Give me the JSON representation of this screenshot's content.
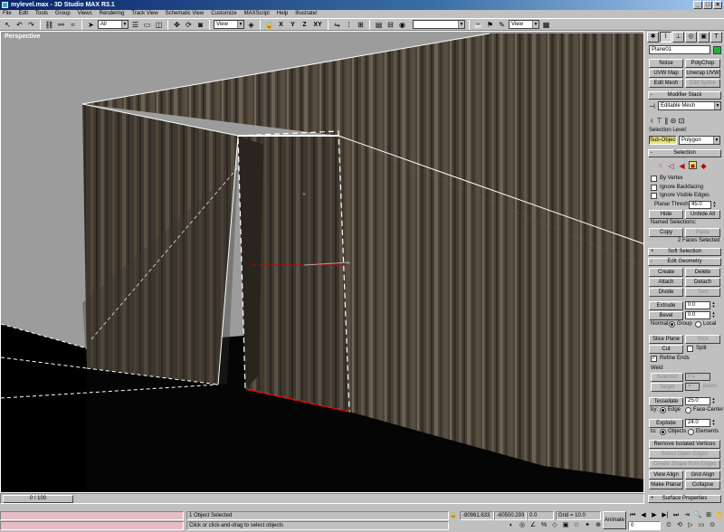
{
  "window": {
    "title": "mylevel.max - 3D Studio MAX R3.1",
    "buttons": [
      "_",
      "□",
      "×"
    ]
  },
  "menu": [
    "File",
    "Edit",
    "Tools",
    "Group",
    "Views",
    "Rendering",
    "Track View",
    "Schematic View",
    "Customize",
    "MAXScript",
    "Help",
    "Illustrate!"
  ],
  "toolbar": {
    "selection_filter": "All",
    "ref_coord": "View",
    "axis_labels": [
      "X",
      "Y",
      "Z",
      "XY"
    ],
    "named_sel": "",
    "right_view": "View"
  },
  "viewport": {
    "label": "Perspective"
  },
  "command_panel": {
    "tabs": [
      "create",
      "modify",
      "hierarchy",
      "motion",
      "display",
      "utilities"
    ],
    "object_name": "Plane01",
    "object_color": "#1fb040",
    "modifier_buttons": [
      "Noise",
      "PolyChop",
      "UVW Map",
      "Unwrap UVW",
      "Edit Mesh",
      "Edit Spline"
    ],
    "modifier_stack": {
      "title": "Modifier Stack",
      "current": "Editable Mesh",
      "selection_level_label": "Selection Level:",
      "sub_object": "Sub-Object",
      "level": "Polygon"
    },
    "selection": {
      "title": "Selection",
      "by_vertex": "By Vertex",
      "ignore_backfacing": "Ignore Backfacing",
      "ignore_visible_edges": "Ignore Visible Edges",
      "planar_thresh_label": "Planar Thresh:",
      "planar_thresh": "45.0",
      "hide": "Hide",
      "unhide_all": "Unhide All",
      "named_selections": "Named Selections:",
      "copy": "Copy",
      "paste": "Paste",
      "status": "2 Faces Selected"
    },
    "soft_selection": {
      "title": "Soft Selection"
    },
    "edit_geometry": {
      "title": "Edit Geometry",
      "create": "Create",
      "delete": "Delete",
      "attach": "Attach",
      "detach": "Detach",
      "divide": "Divide",
      "turn": "Turn",
      "extrude": "Extrude",
      "extrude_val": "0.0",
      "bevel": "Bevel",
      "bevel_val": "0.0",
      "normal_label": "Normal:",
      "group": "Group",
      "local": "Local",
      "slice_plane": "Slice Plane",
      "slice": "Slice",
      "cut": "Cut",
      "split": "Split",
      "refine_ends": "Refine Ends",
      "weld_label": "Weld",
      "selected": "Selected",
      "selected_val": "0.1",
      "target": "Target",
      "target_val": "4",
      "pixels": "pixels",
      "tessellate": "Tessellate",
      "tess_val": "25.0",
      "by_label": "by:",
      "edge": "Edge",
      "face_center": "Face-Center",
      "explode": "Explode",
      "explode_val": "24.0",
      "to_label": "to:",
      "objects": "Objects",
      "elements": "Elements",
      "remove_isolated": "Remove Isolated Vertices",
      "select_open_edges": "Select Open Edges",
      "create_shape": "Create Shape from Edges",
      "view_align": "View Align",
      "grid_align": "Grid Align",
      "make_planar": "Make Planar",
      "collapse": "Collapse"
    },
    "surface_properties": {
      "title": "Surface Properties"
    }
  },
  "time_slider": {
    "label": "0 / 100"
  },
  "status": {
    "selected": "1 Object Selected",
    "prompt": "Click or click-and-drag to select objects",
    "x": "-80961.633",
    "y": "-60500.293",
    "z": "0.0",
    "grid": "Grid = 10.0",
    "animate": "Animate",
    "frame": "0"
  }
}
